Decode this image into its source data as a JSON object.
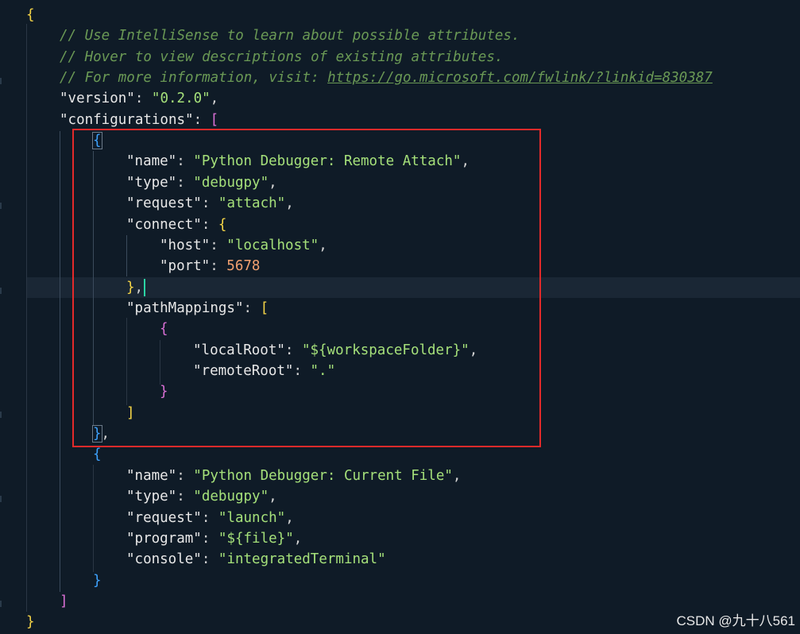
{
  "editor": {
    "comments": [
      "// Use IntelliSense to learn about possible attributes.",
      "// Hover to view descriptions of existing attributes.",
      "// For more information, visit: "
    ],
    "link_url": "https://go.microsoft.com/fwlink/?linkid=830387",
    "version_key": "\"version\"",
    "version_value": "\"0.2.0\"",
    "configurations_key": "\"configurations\"",
    "remote": {
      "name_key": "\"name\"",
      "name_value": "\"Python Debugger: Remote Attach\"",
      "type_key": "\"type\"",
      "type_value": "\"debugpy\"",
      "request_key": "\"request\"",
      "request_value": "\"attach\"",
      "connect_key": "\"connect\"",
      "host_key": "\"host\"",
      "host_value": "\"localhost\"",
      "port_key": "\"port\"",
      "port_value": "5678",
      "pathmappings_key": "\"pathMappings\"",
      "localroot_key": "\"localRoot\"",
      "localroot_value": "\"${workspaceFolder}\"",
      "remoteroot_key": "\"remoteRoot\"",
      "remoteroot_value": "\".\""
    },
    "current": {
      "name_key": "\"name\"",
      "name_value": "\"Python Debugger: Current File\"",
      "type_key": "\"type\"",
      "type_value": "\"debugpy\"",
      "request_key": "\"request\"",
      "request_value": "\"launch\"",
      "program_key": "\"program\"",
      "program_value": "\"${file}\"",
      "console_key": "\"console\"",
      "console_value": "\"integratedTerminal\""
    }
  },
  "watermark": "CSDN @九十八561",
  "colors": {
    "background": "#0f1b27",
    "highlight_box": "#e32a2a",
    "string": "#a5e07a",
    "number": "#f0a070",
    "comment": "#6a9955"
  }
}
